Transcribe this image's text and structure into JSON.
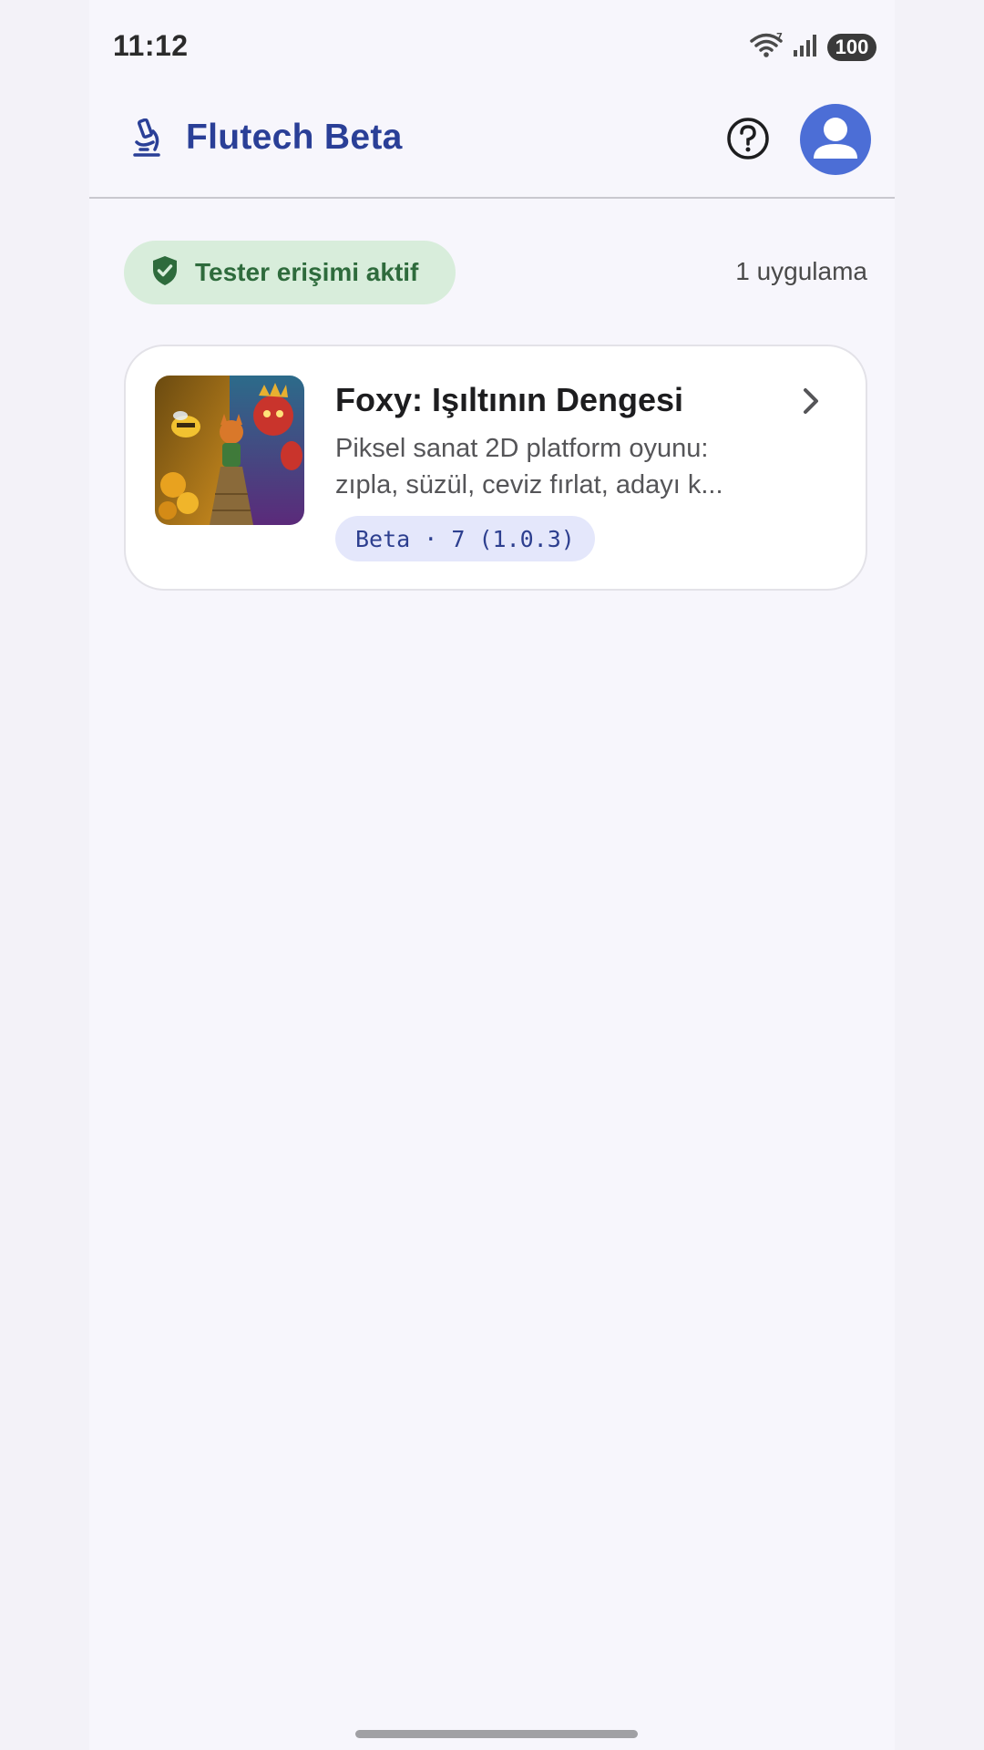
{
  "status_bar": {
    "time": "11:12",
    "battery": "100",
    "icons": [
      "wifi-icon",
      "signal-icon",
      "battery-icon"
    ]
  },
  "app_bar": {
    "logo_icon": "microscope-icon",
    "title": "Flutech Beta",
    "help_icon": "help-circle-icon",
    "profile_icon": "account-circle-icon"
  },
  "access": {
    "icon": "shield-check-icon",
    "label": "Tester erişimi aktif",
    "app_count": "1 uygulama"
  },
  "apps": [
    {
      "name": "Foxy: Işıltının Dengesi",
      "description": "Piksel sanat 2D platform oyunu: zıpla, süzül, ceviz fırlat, adayı k...",
      "version": "Beta · 7 (1.0.3)",
      "thumbnail_icon": "app-thumbnail",
      "chevron_icon": "chevron-right-icon"
    }
  ],
  "colors": {
    "primary": "#2a3f97",
    "avatar": "#4c6ed6",
    "chip_bg": "#d8eddb",
    "chip_text": "#2e6b3c",
    "pill_bg": "#e4e7fb",
    "background": "#f7f6fc"
  }
}
